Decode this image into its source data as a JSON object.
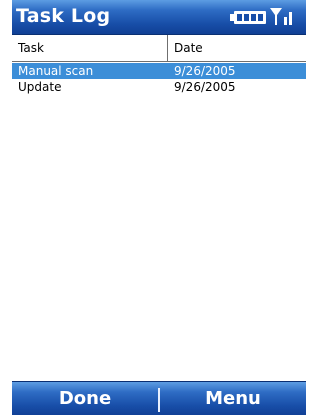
{
  "title": "Task Log",
  "status_icons": [
    "battery-icon",
    "signal-icon"
  ],
  "columns": {
    "task": "Task",
    "date": "Date"
  },
  "rows": [
    {
      "task": "Manual scan",
      "date": "9/26/2005",
      "selected": true
    },
    {
      "task": "Update",
      "date": "9/26/2005",
      "selected": false
    }
  ],
  "softkeys": {
    "left": "Done",
    "right": "Menu"
  },
  "colors": {
    "title_bar": "#184ea8",
    "selection": "#3c8ed8",
    "text_on_bar": "#ffffff"
  }
}
